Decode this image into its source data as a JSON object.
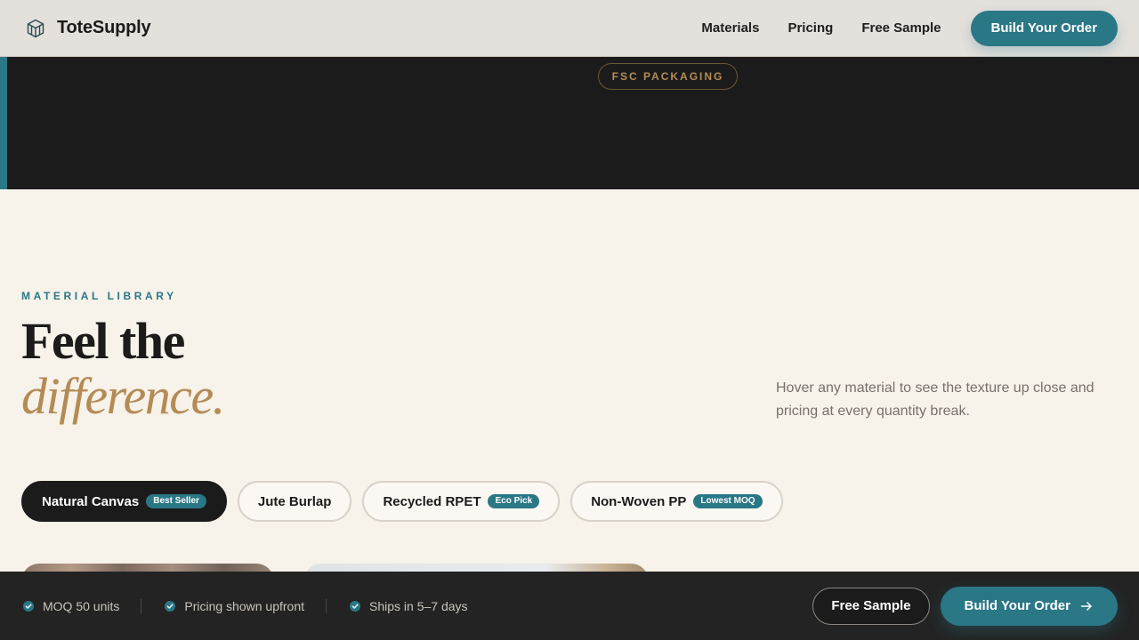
{
  "brand": {
    "name": "ToteSupply",
    "logo_icon": "box-logo-icon"
  },
  "nav": {
    "links": [
      "Materials",
      "Pricing",
      "Free Sample"
    ],
    "cta_label": "Build Your Order"
  },
  "hero": {
    "badge": "FSC PACKAGING"
  },
  "library": {
    "eyebrow": "MATERIAL LIBRARY",
    "headline": "Feel the",
    "headline_accent": "difference.",
    "intro": "Hover any material to see the texture up close and pricing at every quantity break.",
    "tabs": [
      {
        "label": "Natural Canvas",
        "badge": "Best Seller",
        "active": true
      },
      {
        "label": "Jute Burlap",
        "badge": "",
        "active": false
      },
      {
        "label": "Recycled RPET",
        "badge": "Eco Pick",
        "active": false
      },
      {
        "label": "Non-Woven PP",
        "badge": "Lowest MOQ",
        "active": false
      }
    ]
  },
  "bottom_bar": {
    "features": [
      "MOQ 50 units",
      "Pricing shown upfront",
      "Ships in 5–7 days"
    ],
    "secondary_label": "Free Sample",
    "primary_label": "Build Your Order"
  },
  "colors": {
    "accent": "#2a7786",
    "gold": "#b58b55",
    "dark": "#1b1b1b",
    "cream": "#f7f2ea"
  }
}
